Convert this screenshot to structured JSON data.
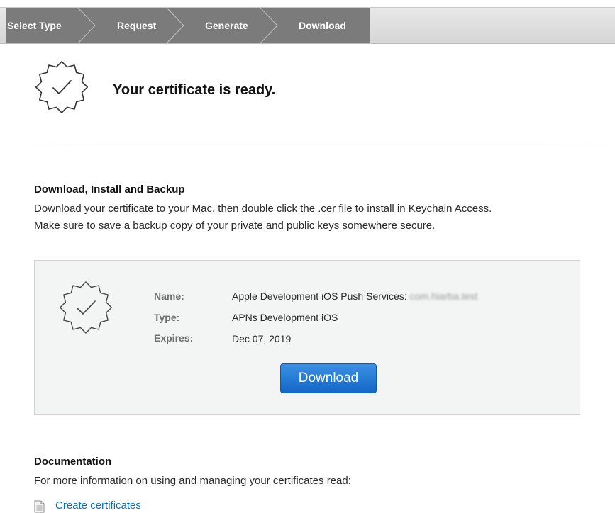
{
  "steps": {
    "items": [
      "Select Type",
      "Request",
      "Generate",
      "Download"
    ],
    "active": "Download"
  },
  "header": {
    "title": "Your certificate is ready."
  },
  "download_section": {
    "title": "Download, Install and Backup",
    "line1": "Download your certificate to your Mac, then double click the .cer file to install in Keychain Access.",
    "line2": "Make sure to save a backup copy of your private and public keys somewhere secure."
  },
  "certificate": {
    "name_label": "Name:",
    "name_value": "Apple Development iOS Push Services:",
    "name_value_redacted": "com.hiarba.test",
    "type_label": "Type:",
    "type_value": "APNs Development iOS",
    "expires_label": "Expires:",
    "expires_value": "Dec 07, 2019",
    "download_button": "Download"
  },
  "documentation": {
    "title": "Documentation",
    "text": "For more information on using and managing your certificates read:",
    "link": "Create certificates"
  },
  "colors": {
    "step_bar_bg": "#7b7b7b",
    "button_blue": "#1a73d0",
    "link_blue": "#0070c9",
    "panel_bg": "#f3f4f4"
  },
  "icons": {
    "seal": "certificate-seal-checkmark-icon",
    "doc": "document-icon"
  }
}
